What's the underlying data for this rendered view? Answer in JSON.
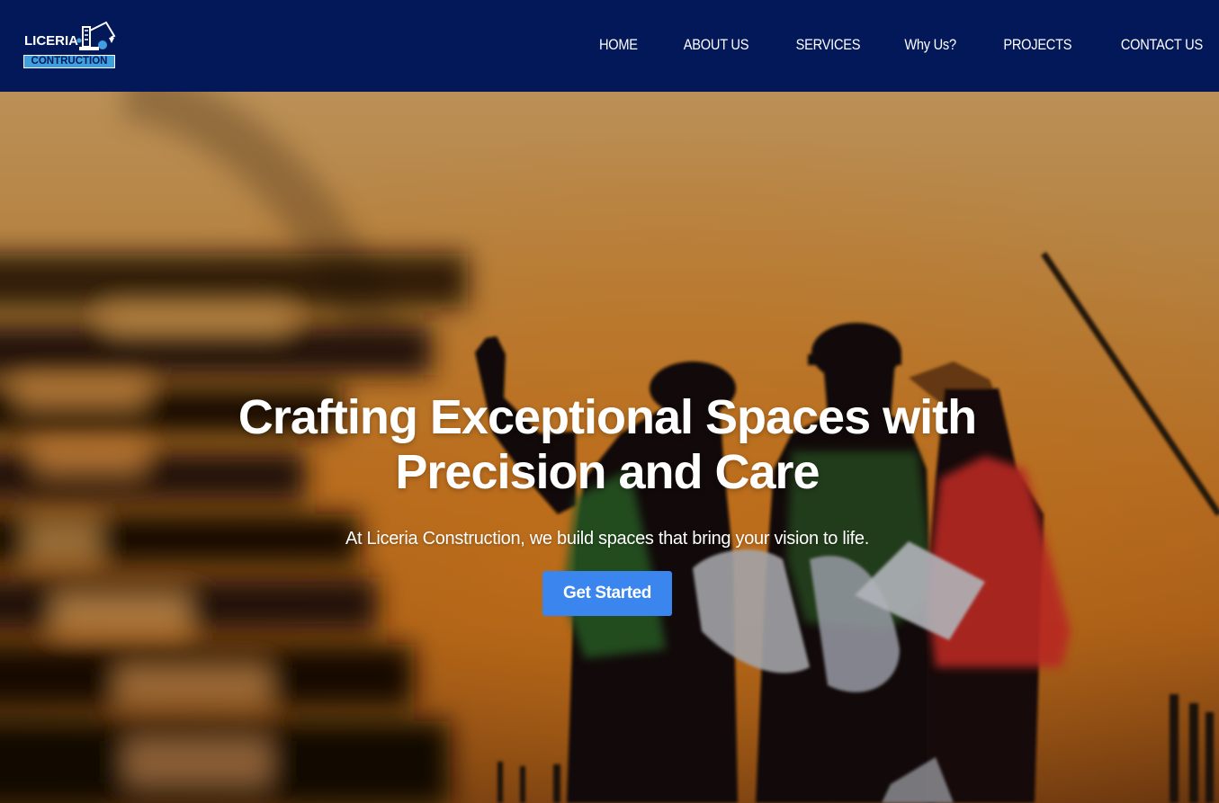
{
  "brand": {
    "logo_word": "LICERIA",
    "logo_sub": "CONTRUCTION",
    "icon": "excavator-icon"
  },
  "nav": {
    "items": [
      {
        "label": "HOME"
      },
      {
        "label": "ABOUT US"
      },
      {
        "label": "SERVICES"
      },
      {
        "label": "Why Us?"
      },
      {
        "label": "PROJECTS"
      },
      {
        "label": "CONTACT US"
      }
    ]
  },
  "hero": {
    "title": "Crafting Exceptional Spaces with Precision and Care",
    "subtitle": "At Liceria Construction, we build spaces that bring your vision to life.",
    "cta_label": "Get Started"
  },
  "colors": {
    "header_bg": "#021858",
    "cta_bg": "#3a86ee",
    "logo_accent": "#3fa0e0"
  }
}
